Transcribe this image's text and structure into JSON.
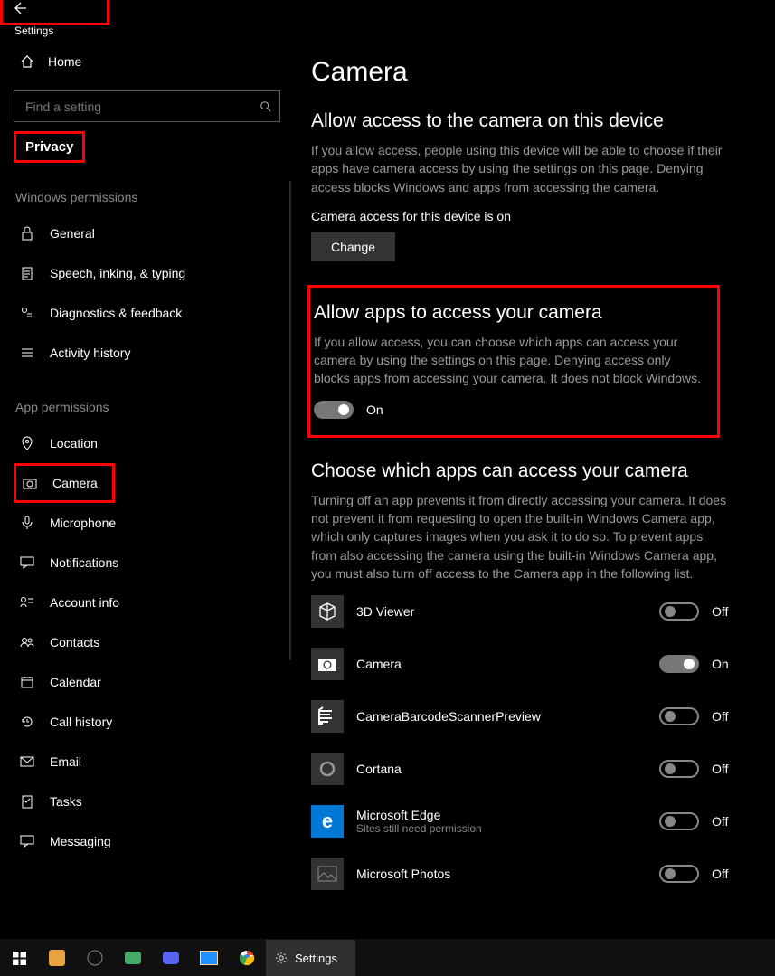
{
  "header": {
    "title": "Settings"
  },
  "sidebar": {
    "home": "Home",
    "search_placeholder": "Find a setting",
    "category": "Privacy",
    "section1": "Windows permissions",
    "section2": "App permissions",
    "win_perms": [
      {
        "label": "General"
      },
      {
        "label": "Speech, inking, & typing"
      },
      {
        "label": "Diagnostics & feedback"
      },
      {
        "label": "Activity history"
      }
    ],
    "app_perms": [
      {
        "label": "Location"
      },
      {
        "label": "Camera"
      },
      {
        "label": "Microphone"
      },
      {
        "label": "Notifications"
      },
      {
        "label": "Account info"
      },
      {
        "label": "Contacts"
      },
      {
        "label": "Calendar"
      },
      {
        "label": "Call history"
      },
      {
        "label": "Email"
      },
      {
        "label": "Tasks"
      },
      {
        "label": "Messaging"
      }
    ]
  },
  "main": {
    "title": "Camera",
    "device": {
      "heading": "Allow access to the camera on this device",
      "desc": "If you allow access, people using this device will be able to choose if their apps have camera access by using the settings on this page. Denying access blocks Windows and apps from accessing the camera.",
      "status": "Camera access for this device is on",
      "change": "Change"
    },
    "apps": {
      "heading": "Allow apps to access your camera",
      "desc": "If you allow access, you can choose which apps can access your camera by using the settings on this page. Denying access only blocks apps from accessing your camera. It does not block Windows.",
      "state": "On"
    },
    "choose": {
      "heading": "Choose which apps can access your camera",
      "desc": "Turning off an app prevents it from directly accessing your camera. It does not prevent it from requesting to open the built-in Windows Camera app, which only captures images when you ask it to do so. To prevent apps from also accessing the camera using the built-in Windows Camera app, you must also turn off access to the Camera app in the following list.",
      "list": [
        {
          "name": "3D Viewer",
          "state": "Off",
          "sub": ""
        },
        {
          "name": "Camera",
          "state": "On",
          "sub": ""
        },
        {
          "name": "CameraBarcodeScannerPreview",
          "state": "Off",
          "sub": ""
        },
        {
          "name": "Cortana",
          "state": "Off",
          "sub": ""
        },
        {
          "name": "Microsoft Edge",
          "state": "Off",
          "sub": "Sites still need permission"
        },
        {
          "name": "Microsoft Photos",
          "state": "Off",
          "sub": ""
        }
      ]
    }
  },
  "taskbar": {
    "active": "Settings"
  }
}
